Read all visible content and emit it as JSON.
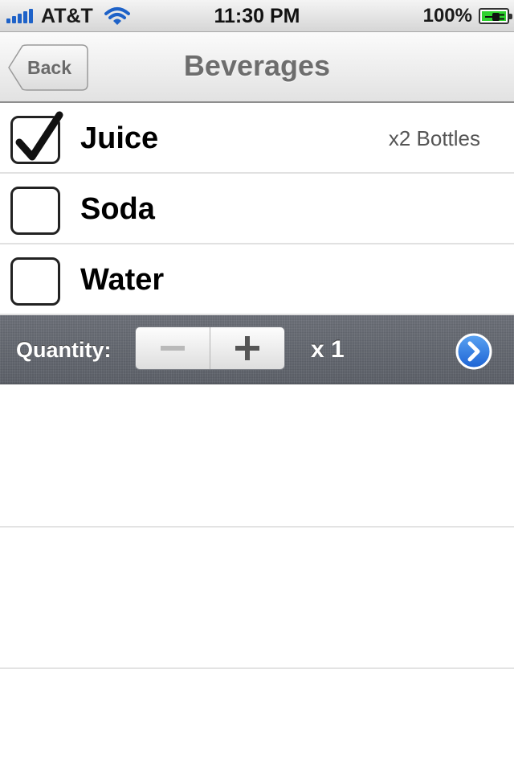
{
  "status_bar": {
    "carrier": "AT&T",
    "time": "11:30 PM",
    "battery_percent": "100%",
    "icons": [
      "signal-bars-icon",
      "wifi-icon",
      "battery-charging-icon"
    ]
  },
  "nav": {
    "back_label": "Back",
    "title": "Beverages"
  },
  "items": [
    {
      "label": "Juice",
      "checked": true,
      "detail": "x2 Bottles"
    },
    {
      "label": "Soda",
      "checked": false,
      "detail": ""
    },
    {
      "label": "Water",
      "checked": false,
      "detail": ""
    }
  ],
  "quantity_bar": {
    "label": "Quantity:",
    "value": "x 1",
    "decrement_icon": "minus-icon",
    "increment_icon": "plus-icon",
    "disclosure_icon": "chevron-right-circle-icon"
  },
  "colors": {
    "signal": "#1e62c8",
    "battery": "#2fd12f",
    "quantity_bar": "#62666e",
    "disclosure": "#2a7be4"
  }
}
